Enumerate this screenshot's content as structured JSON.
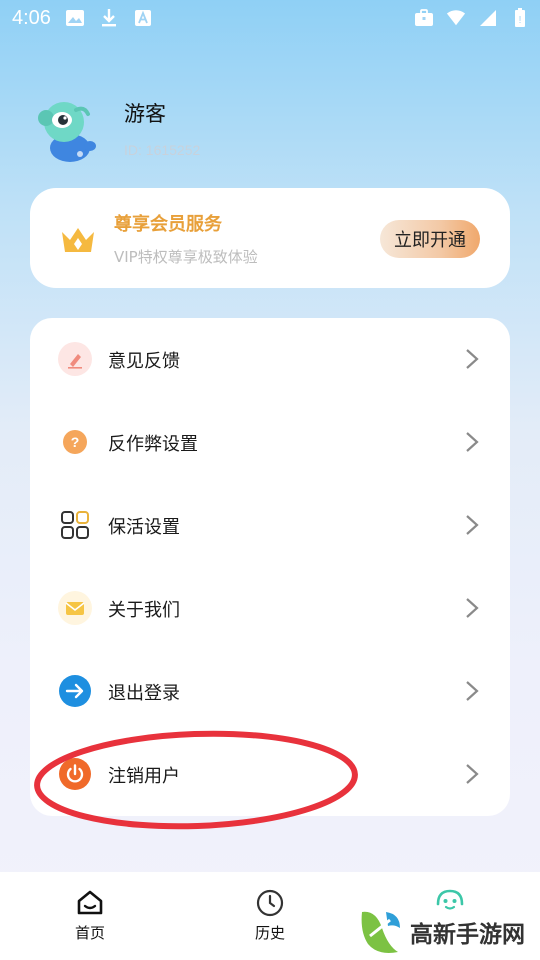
{
  "status_bar": {
    "time": "4:06",
    "left_icons": [
      "image-icon",
      "download-icon",
      "a-box-icon"
    ],
    "right_icons": [
      "briefcase-icon",
      "wifi-icon",
      "cell-signal-icon",
      "battery-icon"
    ]
  },
  "profile": {
    "name": "游客",
    "id_text": "ID: 1615252"
  },
  "vip": {
    "title": "尊享会员服务",
    "subtitle": "VIP特权尊享极致体验",
    "button_label": "立即开通",
    "accent": "#e8a03a"
  },
  "menu": {
    "items": [
      {
        "label": "意见反馈",
        "icon": "feedback-icon"
      },
      {
        "label": "反作弊设置",
        "icon": "question-icon"
      },
      {
        "label": "保活设置",
        "icon": "grid-icon"
      },
      {
        "label": "关于我们",
        "icon": "mail-icon"
      },
      {
        "label": "退出登录",
        "icon": "arrow-right-icon"
      },
      {
        "label": "注销用户",
        "icon": "power-icon"
      }
    ]
  },
  "tab_bar": {
    "tabs": [
      {
        "label": "首页",
        "icon": "home-icon"
      },
      {
        "label": "历史",
        "icon": "clock-icon"
      },
      {
        "label": "",
        "icon": "mascot-face-icon"
      }
    ]
  },
  "watermark": {
    "text": "高新手游网"
  },
  "colors": {
    "highlight_ring": "#e8323c",
    "tab_active": "#3cc7a8"
  }
}
